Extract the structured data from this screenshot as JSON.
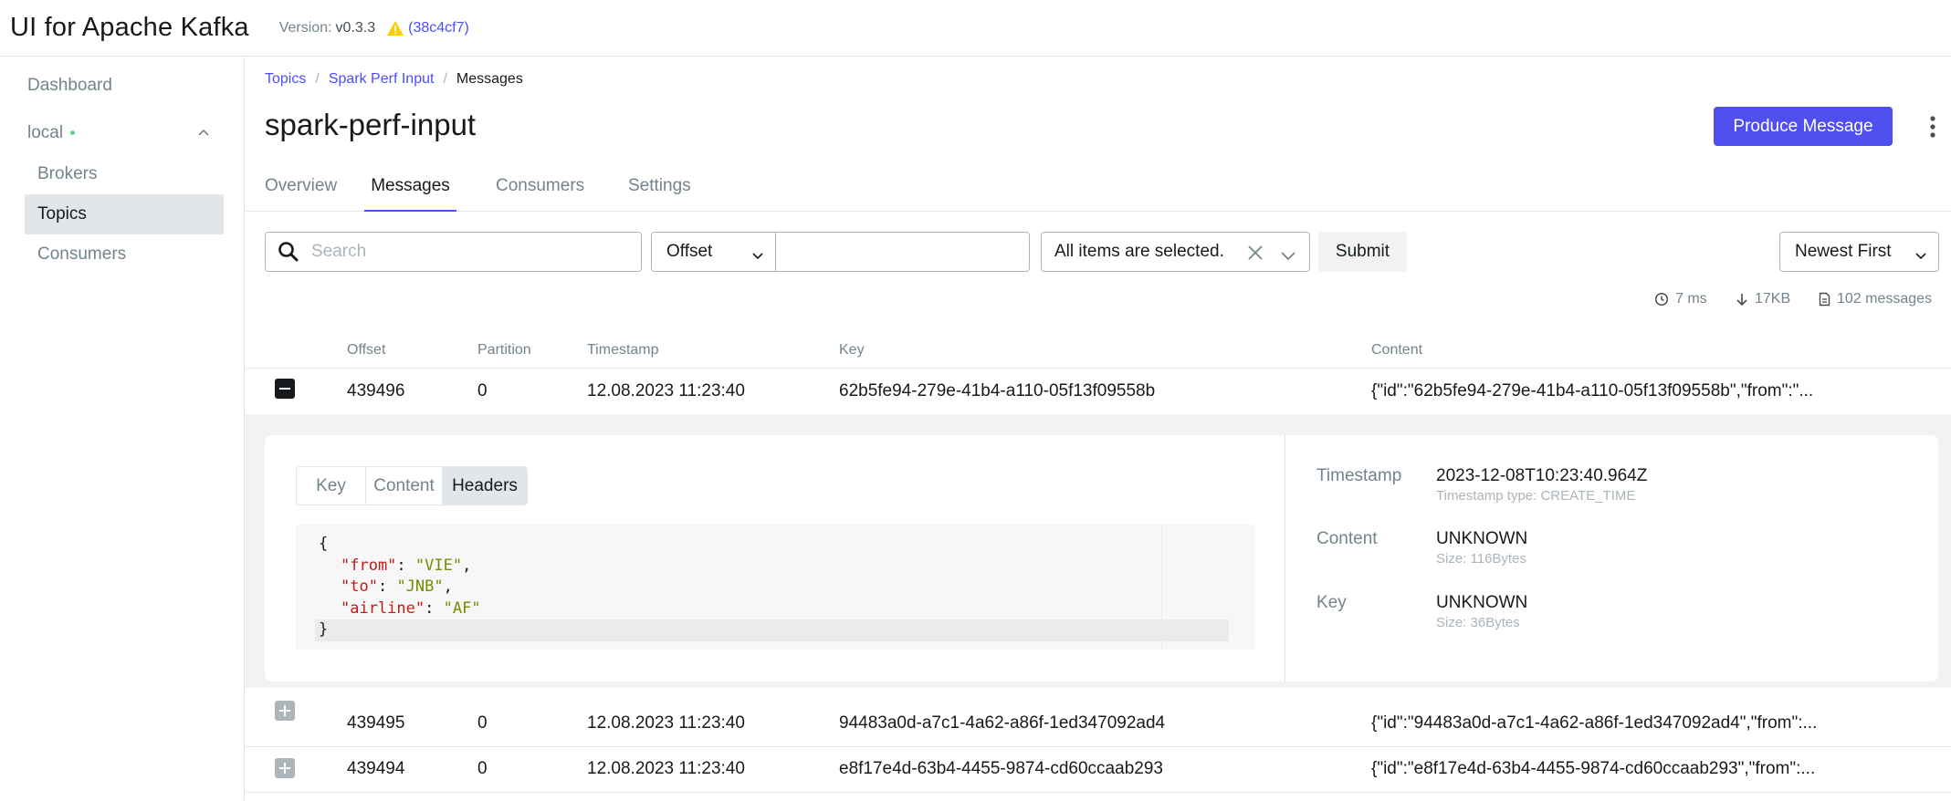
{
  "header": {
    "app_title": "UI for Apache Kafka",
    "version_label": "Version:",
    "version_value": "v0.3.3",
    "commit": "(38c4cf7)"
  },
  "sidebar": {
    "dashboard": "Dashboard",
    "cluster": "local",
    "items": [
      "Brokers",
      "Topics",
      "Consumers"
    ],
    "active_item": "Topics"
  },
  "breadcrumb": {
    "topics": "Topics",
    "topic": "Spark Perf Input",
    "current": "Messages"
  },
  "page_title": "spark-perf-input",
  "produce_button": "Produce Message",
  "tabs": [
    "Overview",
    "Messages",
    "Consumers",
    "Settings"
  ],
  "active_tab": "Messages",
  "filters": {
    "search_placeholder": "Search",
    "seek_type": "Offset",
    "offset_value": "",
    "partitions": "All items are selected.",
    "submit": "Submit",
    "sort": "Newest First"
  },
  "stats": {
    "elapsed": "7 ms",
    "bytes": "17KB",
    "messages": "102 messages"
  },
  "table": {
    "columns": [
      "Offset",
      "Partition",
      "Timestamp",
      "Key",
      "Content"
    ],
    "rows": [
      {
        "offset": "439496",
        "partition": "0",
        "timestamp": "12.08.2023 11:23:40",
        "key": "62b5fe94-279e-41b4-a110-05f13f09558b",
        "content": "{\"id\":\"62b5fe94-279e-41b4-a110-05f13f09558b\",\"from\":\"...",
        "expanded": true
      },
      {
        "offset": "439495",
        "partition": "0",
        "timestamp": "12.08.2023 11:23:40",
        "key": "94483a0d-a7c1-4a62-a86f-1ed347092ad4",
        "content": "{\"id\":\"94483a0d-a7c1-4a62-a86f-1ed347092ad4\",\"from\":...",
        "expanded": false
      },
      {
        "offset": "439494",
        "partition": "0",
        "timestamp": "12.08.2023 11:23:40",
        "key": "e8f17e4d-63b4-4455-9874-cd60ccaab293",
        "content": "{\"id\":\"e8f17e4d-63b4-4455-9874-cd60ccaab293\",\"from\":...",
        "expanded": false
      }
    ]
  },
  "expanded": {
    "tabs": [
      "Key",
      "Content",
      "Headers"
    ],
    "active_tab": "Headers",
    "code": {
      "open": "{",
      "lines": [
        {
          "key": "\"from\"",
          "value": "\"VIE\"",
          "trail": ","
        },
        {
          "key": "\"to\"",
          "value": "\"JNB\"",
          "trail": ","
        },
        {
          "key": "\"airline\"",
          "value": "\"AF\"",
          "trail": ""
        }
      ],
      "close": "}"
    },
    "meta": {
      "timestamp_label": "Timestamp",
      "timestamp_value": "2023-12-08T10:23:40.964Z",
      "timestamp_type": "Timestamp type: CREATE_TIME",
      "content_label": "Content",
      "content_value": "UNKNOWN",
      "content_size": "Size: 116Bytes",
      "key_label": "Key",
      "key_value": "UNKNOWN",
      "key_size": "Size: 36Bytes"
    }
  },
  "colors": {
    "accent": "#4c4cff",
    "button": "#4f4ff0",
    "warning": "#ffcc00",
    "status_dot": "#5cd685"
  }
}
